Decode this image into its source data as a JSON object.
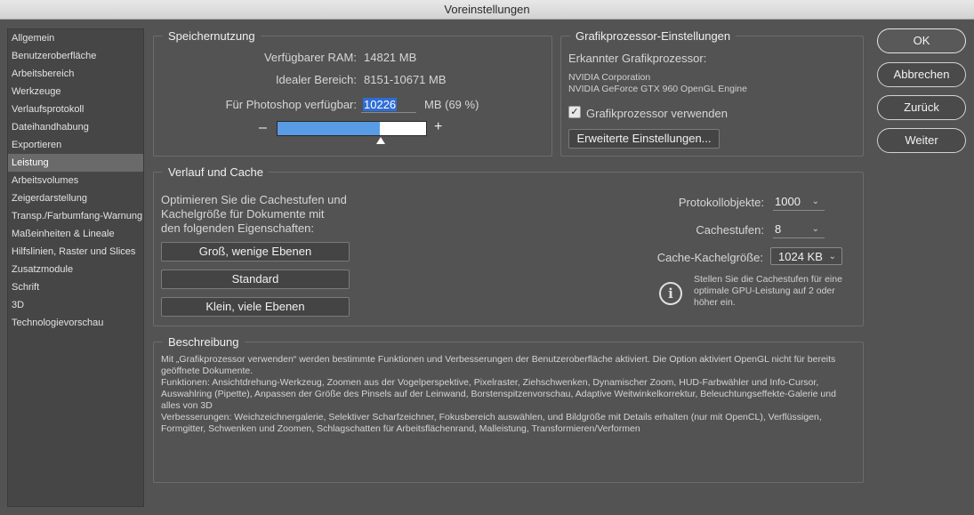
{
  "window": {
    "title": "Voreinstellungen"
  },
  "sidebar": {
    "items": [
      "Allgemein",
      "Benutzeroberfläche",
      "Arbeitsbereich",
      "Werkzeuge",
      "Verlaufsprotokoll",
      "Dateihandhabung",
      "Exportieren",
      "Leistung",
      "Arbeitsvolumes",
      "Zeigerdarstellung",
      "Transp./Farbumfang-Warnung",
      "Maßeinheiten & Lineale",
      "Hilfslinien, Raster und Slices",
      "Zusatzmodule",
      "Schrift",
      "3D",
      "Technologievorschau"
    ],
    "active_index": 7
  },
  "memory": {
    "title": "Speichernutzung",
    "available_label": "Verfügbarer RAM:",
    "available_value": "14821 MB",
    "ideal_label": "Idealer Bereich:",
    "ideal_value": "8151-10671 MB",
    "photoshop_label": "Für Photoshop verfügbar:",
    "photoshop_value": "10226",
    "unit_percent": "MB (69 %)",
    "minus": "–",
    "plus": "+",
    "slider_fraction": 0.69
  },
  "gpu": {
    "title": "Grafikprozessor-Einstellungen",
    "detected_label": "Erkannter Grafikprozessor:",
    "vendor": "NVIDIA Corporation",
    "model": "NVIDIA GeForce GTX 960 OpenGL Engine",
    "use_gpu_label": "Grafikprozessor verwenden",
    "use_gpu_checked": true,
    "checkmark": "✓",
    "advanced_button": "Erweiterte Einstellungen..."
  },
  "history": {
    "title": "Verlauf und Cache",
    "optimize_lines": [
      "Optimieren Sie die Cachestufen und",
      "Kachelgröße für Dokumente mit",
      "den folgenden Eigenschaften:"
    ],
    "preset_large": "Groß, wenige Ebenen",
    "preset_standard": "Standard",
    "preset_small": "Klein, viele Ebenen",
    "protocol_label": "Protokollobjekte:",
    "protocol_value": "1000",
    "cache_levels_label": "Cachestufen:",
    "cache_levels_value": "8",
    "tile_size_label": "Cache-Kachelgröße:",
    "tile_size_value": "1024 KB",
    "info_lines": [
      "Stellen Sie die Cachestufen für eine",
      "optimale GPU-Leistung auf 2 oder",
      "höher ein."
    ],
    "info_glyph": "i",
    "chevron": "⌄"
  },
  "description": {
    "title": "Beschreibung",
    "lines": [
      "Mit „Grafikprozessor verwenden“ werden bestimmte Funktionen und Verbesserungen der Benutzeroberfläche aktiviert. Die Option aktiviert OpenGL nicht für bereits geöffnete Dokumente.",
      "Funktionen: Ansichtdrehung-Werkzeug, Zoomen aus der Vogelperspektive, Pixelraster, Ziehschwenken, Dynamischer Zoom, HUD-Farbwähler und Info-Cursor, Auswahlring (Pipette), Anpassen der Größe des Pinsels auf der Leinwand, Borstenspitzenvorschau, Adaptive Weitwinkelkorrektur, Beleuchtungseffekte-Galerie und alles von 3D",
      "Verbesserungen: Weichzeichnergalerie, Selektiver Scharfzeichner, Fokusbereich auswählen, und Bildgröße mit Details erhalten (nur mit OpenCL), Verflüssigen, Formgitter, Schwenken und Zoomen, Schlagschatten für Arbeitsflächenrand, Malleistung, Transformieren/Verformen"
    ]
  },
  "actions": {
    "ok": "OK",
    "cancel": "Abbrechen",
    "back": "Zurück",
    "next": "Weiter"
  }
}
